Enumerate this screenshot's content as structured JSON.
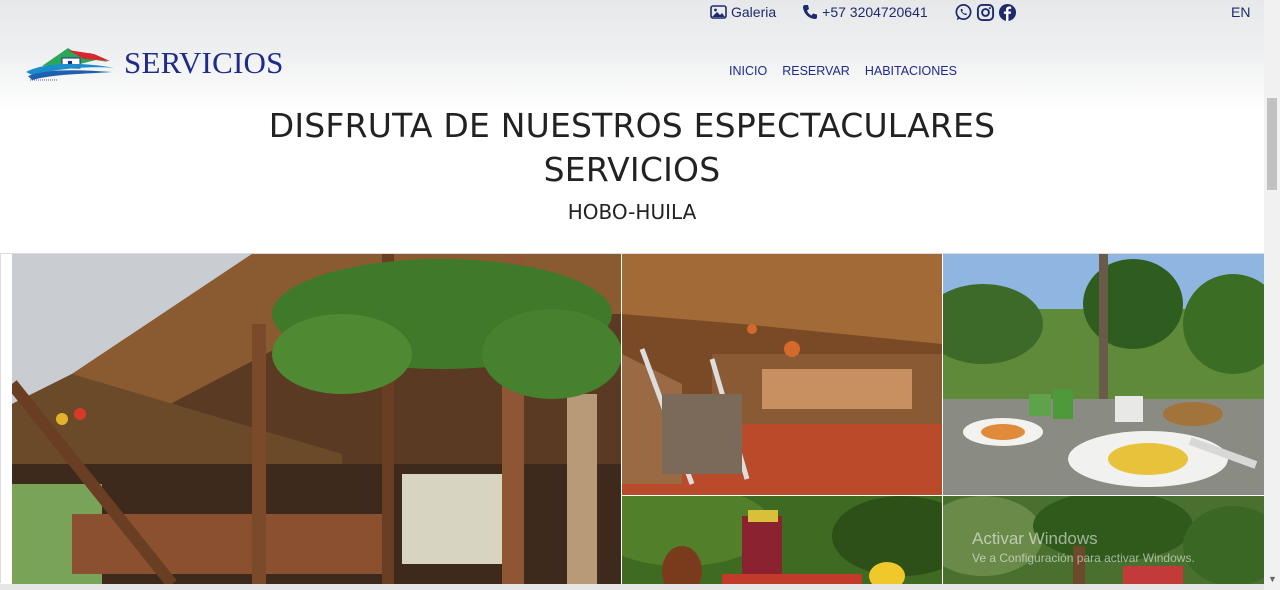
{
  "header": {
    "gallery_label": "Galeria",
    "phone": "+57 3204720641",
    "lang": "EN",
    "logo_text": "SERVICIOS",
    "nav": [
      "INICIO",
      "RESERVAR",
      "HABITACIONES"
    ],
    "icons": [
      "gallery-icon",
      "phone-icon",
      "whatsapp-icon",
      "instagram-icon",
      "facebook-icon"
    ]
  },
  "hero": {
    "title_line1": "DISFRUTA DE NUESTROS ESPECTACULARES",
    "title_line2": "SERVICIOS",
    "subtitle": "HOBO-HUILA"
  },
  "gallery": {
    "photos": [
      "restaurant-interior-photo",
      "dining-hall-photo",
      "breakfast-table-photo",
      "drink-fruit-photo",
      "garden-plants-photo"
    ]
  },
  "watermark": {
    "line1": "Activar Windows",
    "line2": "Ve a Configuración para activar Windows."
  },
  "colors": {
    "brand": "#1f2a8a",
    "header_bg": "#e7e8ea"
  }
}
